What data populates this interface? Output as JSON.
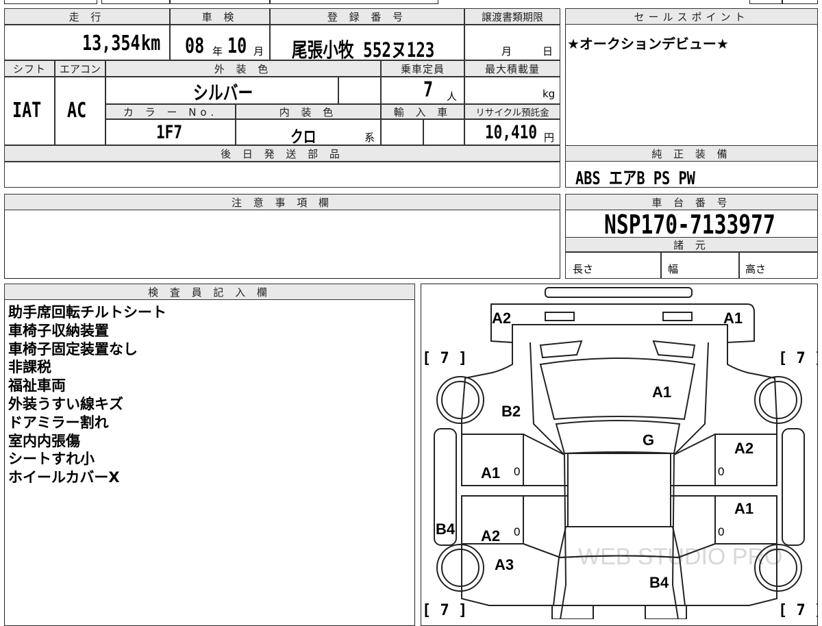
{
  "headers": {
    "mileage": "走 行",
    "inspection": "車 検",
    "registration": "登 録 番 号",
    "transfer_deadline": "譲渡書類期限",
    "sales_point": "セールスポイント",
    "shift": "シフト",
    "aircon": "エアコン",
    "exterior_color": "外 装 色",
    "capacity": "乗車定員",
    "max_load": "最大積載量",
    "color_no": "カ ラ ー No.",
    "interior_color": "内 装 色",
    "import": "輸 入 車",
    "recycle": "リサイクル預託金",
    "later_parts": "後 日 発 送 部 品",
    "genuine_equipment": "純 正 装 備",
    "caution": "注 意 事 項 欄",
    "chassis_number": "車 台 番 号",
    "specs": "諸 元",
    "inspector": "検 査 員 記 入 欄"
  },
  "values": {
    "mileage": "13,354",
    "mileage_unit": "km",
    "inspection_year": "08",
    "inspection_year_unit": "年",
    "inspection_month": "10",
    "inspection_month_unit": "月",
    "registration": "尾張小牧 552ヌ123",
    "deadline_month": "月",
    "deadline_day": "日",
    "sales_point_text": "★オークションデビュー★",
    "shift": "IAT",
    "aircon": "AC",
    "exterior_color": "シルバー",
    "capacity": "7",
    "capacity_unit": "人",
    "max_load_unit": "kg",
    "color_no": "1F7",
    "interior_color": "クロ",
    "interior_suffix": "系",
    "recycle": "10,410",
    "recycle_unit": "円",
    "genuine_equipment": "ABS エアB PS PW",
    "chassis_number": "NSP170-7133977",
    "spec_length": "長さ",
    "spec_width": "幅",
    "spec_height": "高さ"
  },
  "inspector_notes": [
    "助手席回転チルトシート",
    "車椅子収納装置",
    "車椅子固定装置なし",
    "非課税",
    "福祉車両",
    "外装うすい線キズ",
    "ドアミラー割れ",
    "室内内張傷",
    "シートすれ小",
    "ホイールカバーX"
  ],
  "diagram": {
    "labels": [
      "A2",
      "A1",
      "A1",
      "B2",
      "G",
      "A2",
      "A1",
      "A1",
      "B4",
      "A2",
      "A3",
      "B4"
    ],
    "brackets": [
      "[ 7 ]",
      "[ 7 ]",
      "[ 7 ]",
      "[ 7 ]"
    ],
    "zeros": [
      "0",
      "0",
      "0",
      "0"
    ],
    "watermark": "WEB STUDIO PRO"
  }
}
